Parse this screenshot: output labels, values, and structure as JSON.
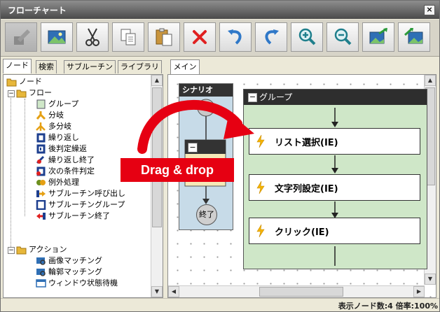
{
  "window": {
    "title": "フローチャート",
    "close_glyph": "×"
  },
  "toolbar": {
    "buttons": [
      {
        "name": "disabled-edit-icon",
        "enabled": false
      },
      {
        "name": "image-icon",
        "enabled": true
      },
      {
        "name": "scissors-cut-icon",
        "enabled": true
      },
      {
        "name": "copy-icon",
        "enabled": true
      },
      {
        "name": "paste-icon",
        "enabled": true
      },
      {
        "name": "delete-x-icon",
        "enabled": true
      },
      {
        "name": "undo-icon",
        "enabled": true
      },
      {
        "name": "redo-icon",
        "enabled": true
      },
      {
        "name": "zoom-in-icon",
        "enabled": true
      },
      {
        "name": "zoom-out-icon",
        "enabled": true
      },
      {
        "name": "fit-screen-icon",
        "enabled": true
      },
      {
        "name": "fit-width-icon",
        "enabled": true
      }
    ]
  },
  "left_tabs": [
    "ノード",
    "検索",
    "サブルーチン",
    "ライブラリ"
  ],
  "tree": {
    "root": "ノード",
    "flow": "フロー",
    "flow_items": [
      "グループ",
      "分岐",
      "多分岐",
      "繰り返し",
      "後判定繰返",
      "繰り返し終了",
      "次の条件判定",
      "例外処理",
      "サブルーチン呼び出し",
      "サブルーチングループ",
      "サブルーチン終了"
    ],
    "action": "アクション",
    "action_items": [
      "画像マッチング",
      "輪郭マッチング",
      "ウィンドウ状態待機"
    ]
  },
  "main_tab": "メイン",
  "scenario": {
    "title": "シナリオ",
    "end_label": "終了",
    "collapse_glyph": "−"
  },
  "group": {
    "title": "グループ",
    "collapse_glyph": "−"
  },
  "nodes": [
    "リスト選択(IE)",
    "文字列設定(IE)",
    "クリック(IE)"
  ],
  "drag_label": "Drag & drop",
  "status": {
    "text": "表示ノード数:4  倍率:100%"
  },
  "colors": {
    "accent_red": "#e60012",
    "group_green": "#cfe7c8",
    "scenario_blue": "#c7dbe8",
    "bolt_yellow": "#f5b400"
  }
}
